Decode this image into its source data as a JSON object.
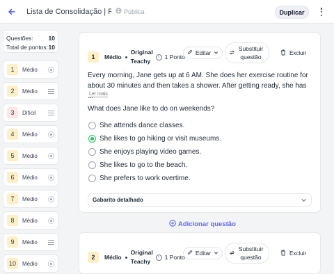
{
  "header": {
    "title": "Lista de Consolidação | Rot...",
    "visibility": "Pública",
    "duplicate_label": "Duplicar"
  },
  "summary": {
    "questions_label": "Questões:",
    "questions_value": "10",
    "points_label": "Total de pontos:",
    "points_value": "10"
  },
  "sidebar_questions": [
    {
      "num": "1",
      "difficulty": "Médio",
      "type": "radio",
      "highlight": false
    },
    {
      "num": "2",
      "difficulty": "Médio",
      "type": "lines",
      "highlight": false
    },
    {
      "num": "3",
      "difficulty": "Difícil",
      "type": "lines",
      "highlight": true
    },
    {
      "num": "4",
      "difficulty": "Médio",
      "type": "radio",
      "highlight": false
    },
    {
      "num": "5",
      "difficulty": "Médio",
      "type": "radio",
      "highlight": false
    },
    {
      "num": "6",
      "difficulty": "Médio",
      "type": "radio",
      "highlight": false
    },
    {
      "num": "7",
      "difficulty": "Médio",
      "type": "radio",
      "highlight": false
    },
    {
      "num": "8",
      "difficulty": "Médio",
      "type": "radio",
      "highlight": false
    },
    {
      "num": "9",
      "difficulty": "Médio",
      "type": "lines",
      "highlight": false
    },
    {
      "num": "10",
      "difficulty": "Médio",
      "type": "radio",
      "highlight": false
    }
  ],
  "cards": [
    {
      "num": "1",
      "difficulty": "Médio",
      "origin": "Original Teachy",
      "points": "1 Ponto",
      "edit_label": "Editar",
      "replace_label": "Substituir questão",
      "delete_label": "Excluir",
      "passage": "Every morning, Jane gets up at 6 AM. She does her exercise routine for about 30 minutes and then takes a shower. After getting ready, she has ...",
      "read_more": "Ler mais",
      "question": "What does Jane like to do on weekends?",
      "options": [
        {
          "text": "She attends dance classes.",
          "selected": false
        },
        {
          "text": "She likes to go hiking or visit museums.",
          "selected": true
        },
        {
          "text": "She enjoys playing video games.",
          "selected": false
        },
        {
          "text": "She likes to go to the beach.",
          "selected": false
        },
        {
          "text": "She prefers to work overtime.",
          "selected": false
        }
      ],
      "answer_key_label": "Gabarito detalhado"
    },
    {
      "num": "2",
      "difficulty": "Médio",
      "origin": "Original Teachy",
      "points": "1 Ponto",
      "edit_label": "Editar",
      "replace_label": "Substituir questão",
      "delete_label": "Excluir"
    }
  ],
  "add_question_label": "Adicionar questão",
  "colors": {
    "accent": "#6366f1",
    "selected": "#22c55e",
    "badge": "#fdf0c7"
  }
}
